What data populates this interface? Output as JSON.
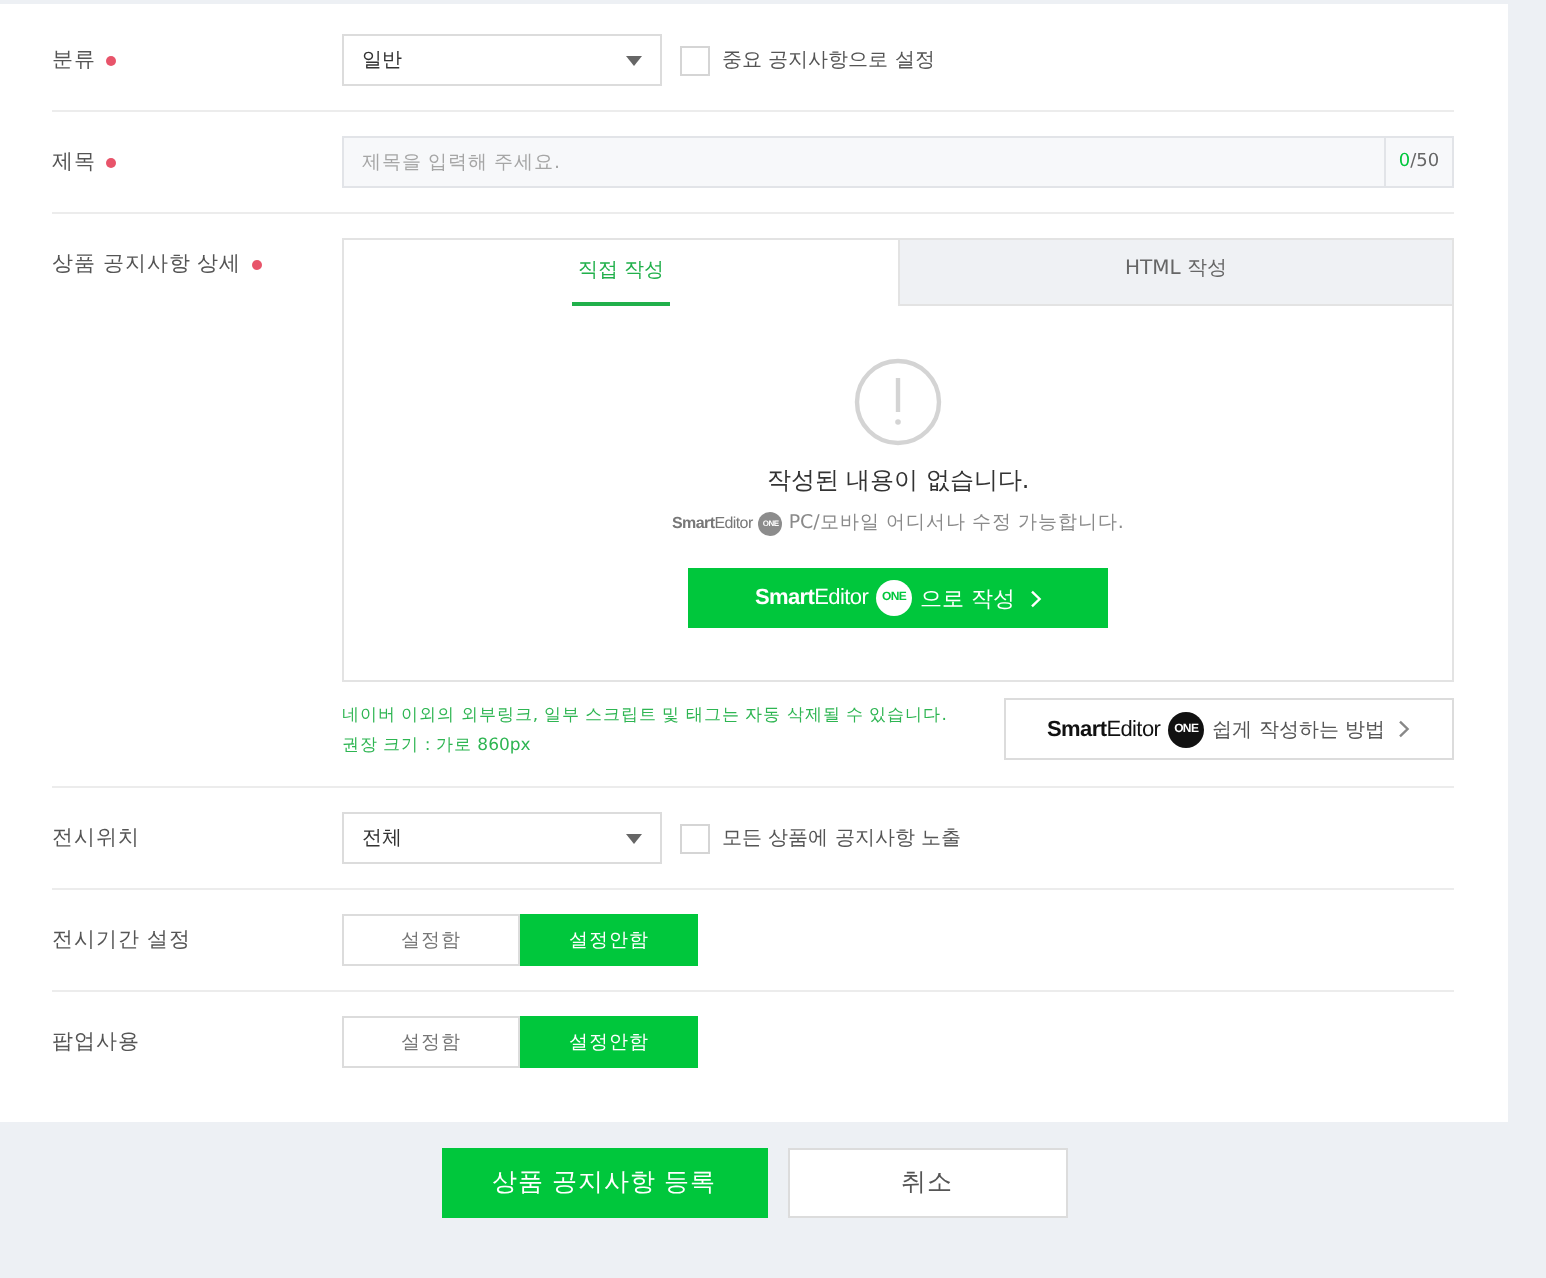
{
  "form": {
    "rows": [
      {
        "kind": "select",
        "label": "분류",
        "required": true,
        "select": {
          "value": "일반"
        },
        "checkbox": {
          "label": "중요 공지사항으로 설정",
          "checked": false
        }
      },
      {
        "kind": "text",
        "label": "제목",
        "required": true,
        "input": {
          "placeholder": "제목을 입력해 주세요.",
          "count": "0",
          "limit": "/50"
        }
      },
      {
        "kind": "editor",
        "label": "상품 공지사항 상세",
        "required": true,
        "editor": {
          "tabs": [
            {
              "label": "직접 작성",
              "selected": true
            },
            {
              "label": "HTML 작성",
              "selected": false
            }
          ],
          "empty_message": "작성된 내용이 없습니다.",
          "hint": {
            "logo": "**Smart**Editor",
            "emblem": "ONE",
            "text": "PC/모바일 어디서나 수정 가능합니다."
          },
          "write_button": {
            "logo": "**Smart**Editor",
            "emblem": "ONE",
            "label": "으로 작성"
          },
          "notes": [
            "네이버 이외의 외부링크, 일부 스크립트 및 태그는 자동 삭제될 수 있습니다.",
            "권장 크기 : 가로 860px"
          ],
          "guide_button": {
            "logo": "**Smart**Editor",
            "emblem": "ONE",
            "label": "쉽게 작성하는 방법"
          }
        }
      },
      {
        "kind": "select",
        "label": "전시위치",
        "required": false,
        "select": {
          "value": "전체"
        },
        "checkbox": {
          "label": "모든 상품에 공지사항 노출",
          "checked": false
        }
      },
      {
        "kind": "toggle",
        "label": "전시기간 설정",
        "required": false,
        "options": [
          {
            "label": "설정함",
            "selected": false
          },
          {
            "label": "설정안함",
            "selected": true
          }
        ]
      },
      {
        "kind": "toggle",
        "label": "팝업사용",
        "required": false,
        "options": [
          {
            "label": "설정함",
            "selected": false
          },
          {
            "label": "설정안함",
            "selected": true
          }
        ]
      }
    ]
  },
  "footer": {
    "buttons": [
      {
        "label": "상품 공지사항 등록",
        "kind": "primary"
      },
      {
        "label": "취소",
        "kind": "secondary"
      }
    ]
  }
}
